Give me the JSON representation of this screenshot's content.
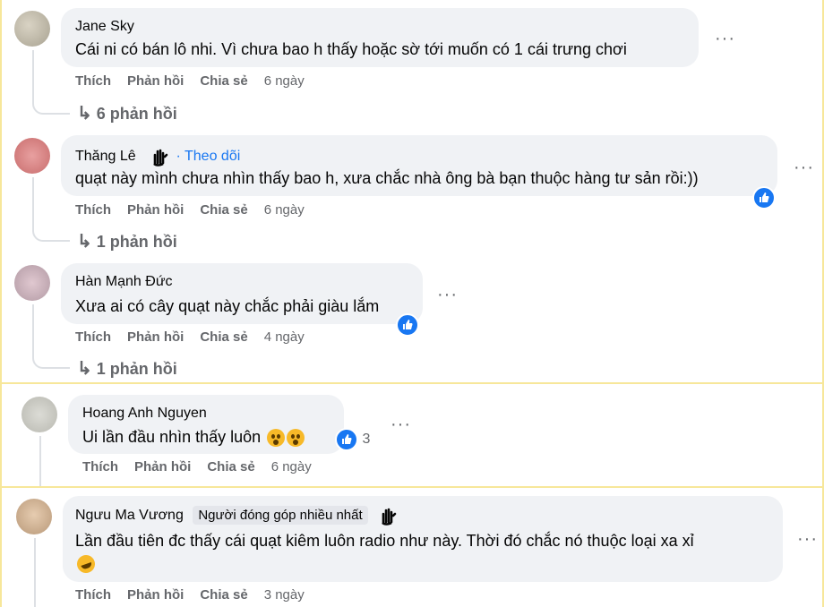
{
  "actions": {
    "like": "Thích",
    "reply": "Phản hồi",
    "share": "Chia sẻ"
  },
  "comments": [
    {
      "author": "Jane Sky",
      "text": "Cái ni có bán lô nhi. Vì chưa bao h thấy hoặc sờ tới muốn có 1 cái trưng chơi",
      "age": "6 ngày",
      "replies": "6 phản hồi"
    },
    {
      "author": "Thăng Lê",
      "follow": "· Theo dõi",
      "text": "quạt này mình chưa nhìn thấy bao h, xưa chắc nhà ông bà bạn thuộc hàng tư sản rồi:))",
      "age": "6 ngày",
      "replies": "1 phản hồi"
    },
    {
      "author": "Hàn Mạnh Đức",
      "text": "Xưa ai có cây quạt này chắc phải giàu lắm",
      "age": "4 ngày",
      "replies": "1 phản hồi"
    },
    {
      "author": "Hoang Anh Nguyen",
      "text": "Ui lần đầu nhìn thấy luôn",
      "age": "6 ngày",
      "reaction_count": "3"
    },
    {
      "author": "Ngưu Ma Vương",
      "badge": "Người đóng góp nhiều nhất",
      "text": "Lần đầu tiên đc thấy cái quạt kiêm luôn radio như này. Thời đó chắc nó thuộc loại xa xỉ",
      "age": "3 ngày"
    }
  ],
  "colors": {
    "accent": "#1877f2",
    "bubble": "#f0f2f5",
    "meta": "#65676b",
    "frame": "#f7e79a"
  }
}
